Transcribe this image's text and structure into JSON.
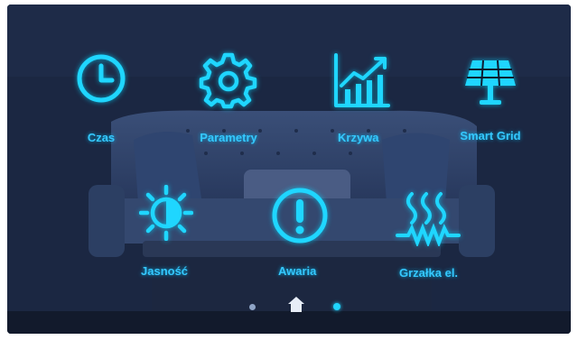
{
  "apps": [
    {
      "id": "czas",
      "label": "Czas",
      "icon": "clock-icon"
    },
    {
      "id": "parametry",
      "label": "Parametry",
      "icon": "gear-icon"
    },
    {
      "id": "krzywa",
      "label": "Krzywa",
      "icon": "chart-icon"
    },
    {
      "id": "smart-grid",
      "label": "Smart Grid",
      "icon": "solar-panel-icon"
    },
    {
      "id": "jasnosc",
      "label": "Jasność",
      "icon": "brightness-icon"
    },
    {
      "id": "awaria",
      "label": "Awaria",
      "icon": "alert-icon"
    },
    {
      "id": "grzalka",
      "label": "Grzałka el.",
      "icon": "heater-icon"
    }
  ],
  "nav": {
    "home_icon": "home-icon",
    "pages": 2,
    "active_page": 1
  },
  "colors": {
    "accent": "#1fd6ff",
    "label": "#35c8ff"
  }
}
